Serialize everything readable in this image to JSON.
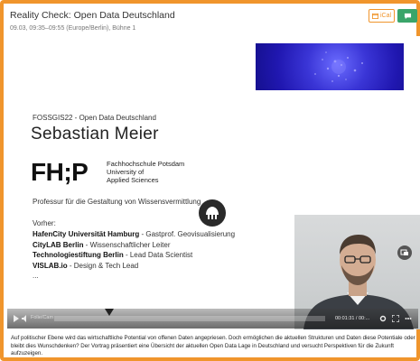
{
  "header": {
    "title": "Reality Check: Open Data Deutschland",
    "meta": "09.03, 09:35–09:55 (Europe/Berlin), Bühne 1",
    "ical_label": "iCal",
    "ical_icon": "calendar-icon",
    "chat_icon": "chat-icon"
  },
  "slide": {
    "subtitle": "FOSSGIS22 - Open Data Deutschland",
    "name": "Sebastian Meier",
    "logo_text": "FH;P",
    "institution_lines": [
      "Fachhochschule Potsdam",
      "University of",
      "Applied Sciences"
    ],
    "professorship": "Professur für die Gestaltung von Wissensvermittlung",
    "previous_heading": "Vorher:",
    "previous_roles": [
      {
        "org": "HafenCity Universität Hamburg",
        "role": " - Gastprof. Geovisualisierung"
      },
      {
        "org": "CityLAB Berlin",
        "role": " - Wissenschaftlicher Leiter"
      },
      {
        "org": "Technologiestiftung Berlin",
        "role": " - Lead Data Scientist"
      },
      {
        "org": "VISLAB.io",
        "role": " - Design & Tech Lead"
      }
    ],
    "ellipsis": "..."
  },
  "player": {
    "label": "Folie/Cam",
    "time": "00:01:31 / 00:..."
  },
  "description": "Auf politischer Ebene wird das wirtschaftliche Potential von offenen Daten angepriesen. Doch ermöglichen die aktuellen Strukturen und Daten diese Potentiale oder bleibt dies Wunschdenken? Der Vortrag präsentiert eine Übersicht der aktuellen Open Data Lage in Deutschland und versucht Perspektiven für die Zukunft aufzuzeigen.",
  "colors": {
    "accent": "#f0952c",
    "chat": "#3aa56a"
  }
}
